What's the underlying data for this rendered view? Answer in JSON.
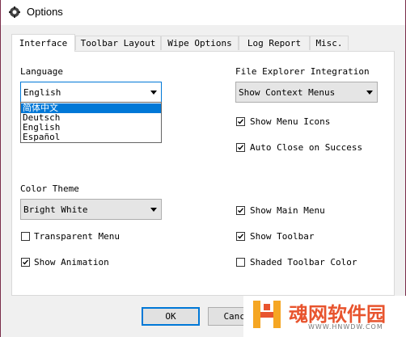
{
  "window": {
    "title": "Options",
    "title_icon": "gear-icon"
  },
  "tabs": [
    {
      "label": "Interface",
      "active": true
    },
    {
      "label": "Toolbar Layout",
      "active": false
    },
    {
      "label": "Wipe Options",
      "active": false
    },
    {
      "label": "Log Report",
      "active": false
    },
    {
      "label": "Misc.",
      "active": false
    }
  ],
  "interface": {
    "language": {
      "label": "Language",
      "value": "English",
      "options": [
        "简体中文",
        "Deutsch",
        "English",
        "Español"
      ],
      "highlighted_option": "简体中文"
    },
    "file_explorer": {
      "label": "File Explorer Integration",
      "value": "Show Context Menus"
    },
    "show_menu_icons": {
      "label": "Show Menu Icons",
      "checked": true
    },
    "auto_close": {
      "label": "Auto Close on Success",
      "checked": true
    },
    "color_theme": {
      "label": "Color Theme",
      "value": "Bright White"
    },
    "transparent_menu": {
      "label": "Transparent Menu",
      "checked": false
    },
    "show_animation": {
      "label": "Show Animation",
      "checked": true
    },
    "show_main_menu": {
      "label": "Show Main Menu",
      "checked": true
    },
    "show_toolbar": {
      "label": "Show Toolbar",
      "checked": true
    },
    "shaded_toolbar": {
      "label": "Shaded Toolbar Color",
      "checked": false
    }
  },
  "buttons": {
    "ok": "OK",
    "cancel": "Cance"
  },
  "watermark": {
    "text": "魂网软件园",
    "url": "WWW.HNWDW.COM",
    "logo": "h-logo-icon"
  },
  "colors": {
    "accent": "#0078d7",
    "window_border": "#7a2d4b",
    "watermark": "#e8542e"
  }
}
